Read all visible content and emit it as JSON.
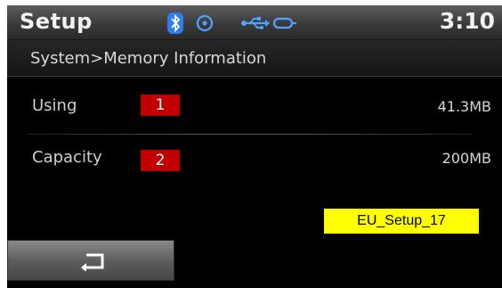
{
  "header": {
    "title": "Setup",
    "clock": "3:10",
    "status_icons": [
      "bluetooth-icon",
      "disc-icon",
      "usb-icon",
      "aux-icon"
    ]
  },
  "breadcrumb": "System>Memory Information",
  "rows": [
    {
      "label": "Using",
      "marker": "1",
      "value": "41.3MB"
    },
    {
      "label": "Capacity",
      "marker": "2",
      "value": "200MB"
    }
  ],
  "reference_tag": "EU_Setup_17",
  "footer": {
    "back_icon": "back-arrow-icon"
  },
  "colors": {
    "marker": "#c00000",
    "reference_tag": "#ffff00",
    "bluetooth": "#2f7df0"
  }
}
